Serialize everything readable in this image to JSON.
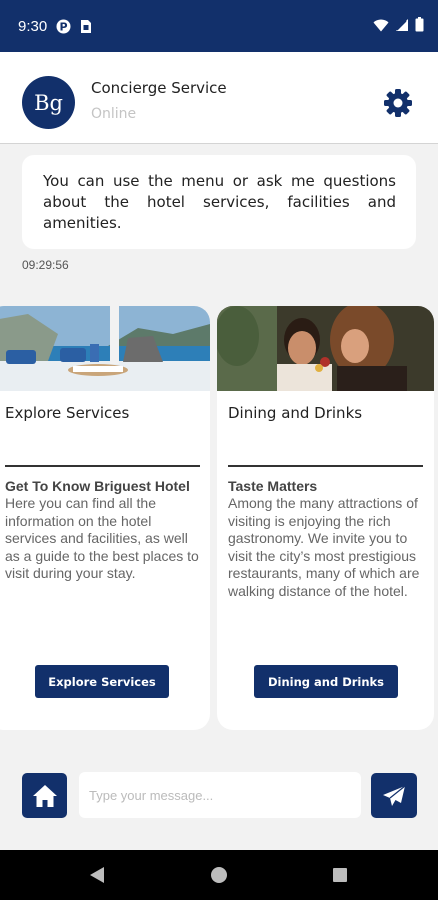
{
  "status_bar": {
    "time": "9:30",
    "left_icons": [
      "pinterest-circle-icon",
      "sim-card-icon"
    ],
    "right_icons": [
      "wifi-icon",
      "signal-icon",
      "battery-icon"
    ]
  },
  "header": {
    "avatar_text": "Bg",
    "title": "Concierge Service",
    "status": "Online",
    "settings_icon": "gear-icon"
  },
  "chat": {
    "message": "You can use the menu or ask me questions about the hotel services, facilities and amenities.",
    "timestamp": "09:29:56"
  },
  "cards": [
    {
      "title": "Explore Services",
      "subtitle": "Get To Know Briguest Hotel",
      "description": "Here you can find all the information on the hotel services and facilities, as well as a guide to the best places to visit during your stay.",
      "button": "Explore Services"
    },
    {
      "title": "Dining and Drinks",
      "subtitle": "Taste Matters",
      "description": "Among the many attractions of visiting is enjoying the rich gastronomy. We invite you to visit the city’s most prestigious restaurants, many of which are walking distance of the hotel.",
      "button": "Dining and Drinks"
    }
  ],
  "composer": {
    "placeholder": "Type your message...",
    "home_icon": "home-icon",
    "send_icon": "send-icon"
  },
  "colors": {
    "brand": "#12306b",
    "background": "#f2f2f2"
  }
}
